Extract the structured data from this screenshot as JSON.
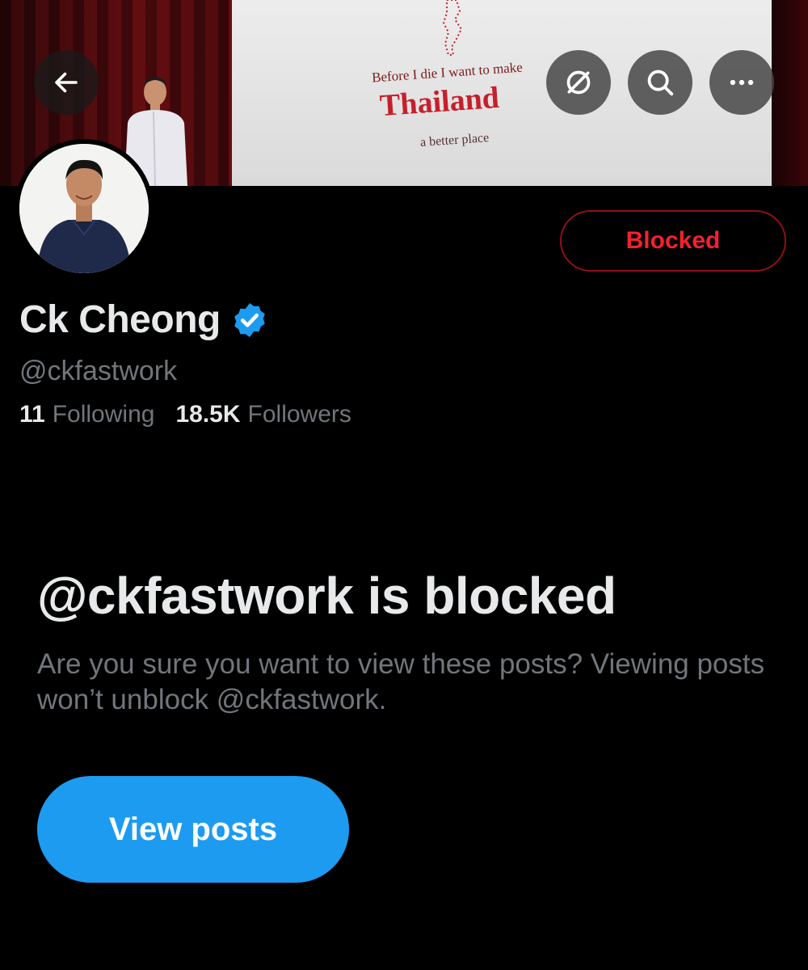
{
  "banner": {
    "screen_line1": "Before I die I want to make",
    "screen_line2": "Thailand",
    "screen_line3": "a better place"
  },
  "header_buttons": {
    "back_icon": "arrow-left-icon",
    "grok_icon": "slash-circle-icon",
    "search_icon": "search-icon",
    "more_icon": "more-horizontal-icon"
  },
  "profile": {
    "name": "Ck Cheong",
    "verified": true,
    "verified_color": "#1d9bf0",
    "handle": "@ckfastwork",
    "following_count": "11",
    "following_label": "Following",
    "followers_count": "18.5K",
    "followers_label": "Followers"
  },
  "actions": {
    "blocked_label": "Blocked",
    "blocked_color": "#f4212e"
  },
  "blocked_notice": {
    "title": "@ckfastwork is blocked",
    "description": "Are you sure you want to view these posts? Viewing posts won’t unblock @ckfastwork.",
    "button_label": "View posts",
    "button_color": "#1d9bf0"
  }
}
